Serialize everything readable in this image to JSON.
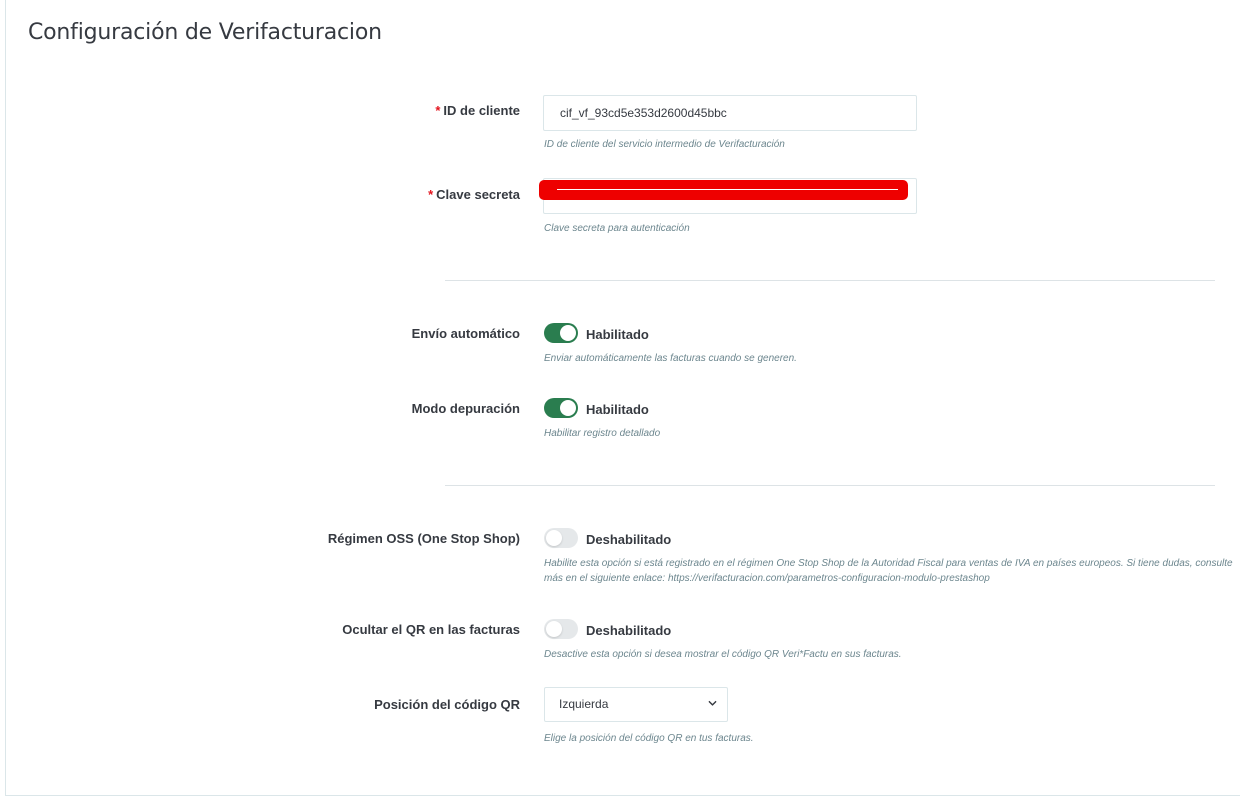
{
  "title": "Configuración de Verifacturacion",
  "required_mark": "*",
  "client_id": {
    "label": "ID de cliente",
    "value": "cif_vf_93cd5e353d2600d45bbc",
    "help": "ID de cliente del servicio intermedio de Verifacturación"
  },
  "secret": {
    "label": "Clave secreta",
    "value": "",
    "help": "Clave secreta para autenticación"
  },
  "auto_send": {
    "label": "Envío automático",
    "state": "Habilitado",
    "enabled": true,
    "help": "Enviar automáticamente las facturas cuando se generen."
  },
  "debug": {
    "label": "Modo depuración",
    "state": "Habilitado",
    "enabled": true,
    "help": "Habilitar registro detallado"
  },
  "oss": {
    "label": "Régimen OSS (One Stop Shop)",
    "state": "Deshabilitado",
    "enabled": false,
    "help_line1": "Habilite esta opción si está registrado en el régimen One Stop Shop de la Autoridad Fiscal para ventas de IVA en países europeos. Si tiene dudas, consulte",
    "help_line2": "más en el siguiente enlace: https://verifacturacion.com/parametros-configuracion-modulo-prestashop"
  },
  "hide_qr": {
    "label": "Ocultar el QR en las facturas",
    "state": "Deshabilitado",
    "enabled": false,
    "help": "Desactive esta opción si desea mostrar el código QR Veri*Factu en sus facturas."
  },
  "qr_position": {
    "label": "Posición del código QR",
    "selected": "Izquierda",
    "help": "Elige la posición del código QR en tus facturas."
  },
  "colors": {
    "toggle_on": "#2a7d4f",
    "toggle_off": "#e5e8ea",
    "required": "#e3131d",
    "redaction": "#ee0000"
  },
  "icons": {
    "select_arrow": "chevron-down-icon"
  }
}
